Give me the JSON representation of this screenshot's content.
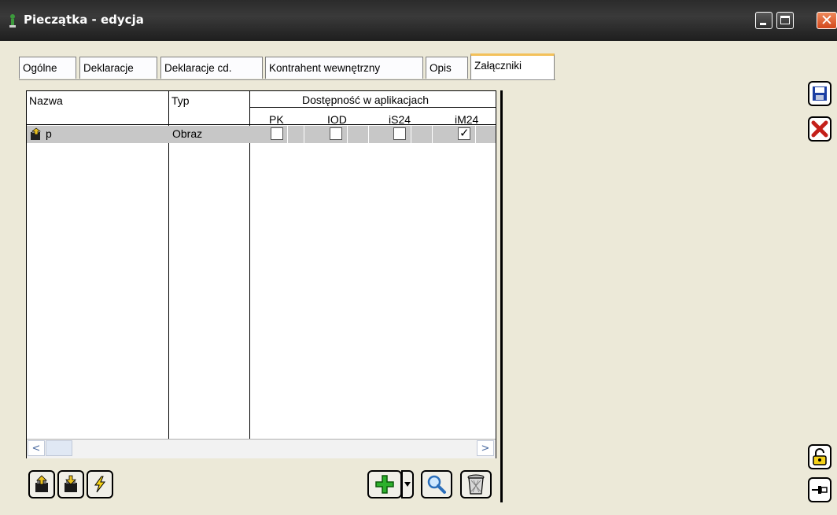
{
  "window": {
    "title": "Pieczątka - edycja",
    "icons": {
      "app": "figure-icon",
      "minimize": "minimize-icon",
      "maximize": "maximize-icon",
      "close": "close-icon"
    }
  },
  "tabs": [
    {
      "label": "Ogólne",
      "active": false
    },
    {
      "label": "Deklaracje",
      "active": false
    },
    {
      "label": "Deklaracje cd.",
      "active": false
    },
    {
      "label": "Kontrahent wewnętrzny",
      "active": false
    },
    {
      "label": "Opis",
      "active": false
    },
    {
      "label": "Załączniki",
      "active": true
    }
  ],
  "grid": {
    "columns": {
      "name": "Nazwa",
      "type": "Typ",
      "availability": "Dostępność w aplikacjach"
    },
    "apps": [
      "PK",
      "IOD",
      "iS24",
      "iM24"
    ],
    "rows": [
      {
        "name": "p",
        "type": "Obraz",
        "checked": [
          false,
          false,
          false,
          true
        ],
        "icon": "attachment-icon"
      }
    ],
    "selected_row_color": "#c7c7c7"
  },
  "scrollbar": {
    "left": "<",
    "right": ">"
  },
  "bottom_toolbar": {
    "left": [
      "add-attachment-icon",
      "extract-attachment-icon",
      "lightning-icon"
    ],
    "right": [
      "add-icon",
      "dropdown-arrow-icon",
      "search-icon",
      "delete-icon"
    ]
  },
  "right_toolbar": [
    "save-icon",
    "cancel-icon",
    "lock-icon",
    "pin-icon"
  ],
  "colors": {
    "titlebar": "#2b2b2b",
    "background": "#ece9d8",
    "active_tab_accent": "#f3c15a",
    "save_blue": "#1c3fa3",
    "cancel_red": "#c4201a"
  }
}
